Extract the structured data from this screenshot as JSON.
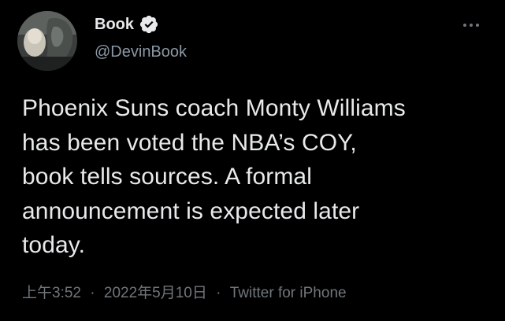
{
  "author": {
    "display_name": "Book",
    "handle": "@DevinBook",
    "verified_icon": "verified-badge-icon",
    "avatar_icon": "avatar"
  },
  "tweet": {
    "text": "Phoenix Suns coach Monty Williams\nhas been voted the NBA’s COY,\nbook tells sources. A formal\nannouncement is expected later\ntoday."
  },
  "meta": {
    "time": "上午3:52",
    "separator": "·",
    "date": "2022年5月10日",
    "source": "Twitter for iPhone"
  },
  "more_icon": "more-options-icon",
  "colors": {
    "background": "#000000",
    "text": "#e7e9ea",
    "secondary": "#71767b",
    "badge": "#e7e9ea"
  }
}
